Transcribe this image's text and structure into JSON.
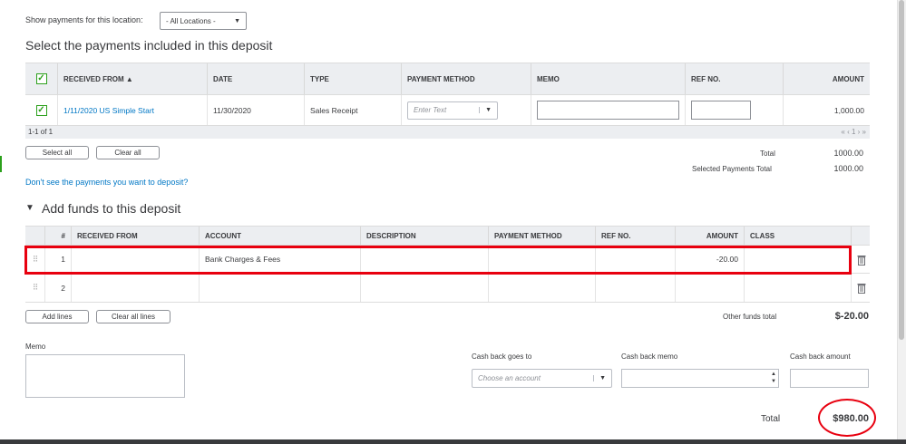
{
  "location_filter": {
    "label": "Show payments for this location:",
    "value": "- All Locations -"
  },
  "payments_section": {
    "title": "Select the payments included in this deposit",
    "columns": [
      "RECEIVED FROM ▲",
      "DATE",
      "TYPE",
      "PAYMENT METHOD",
      "MEMO",
      "REF NO.",
      "AMOUNT"
    ],
    "rows": [
      {
        "received_from": "1/11/2020 US Simple Start",
        "date": "11/30/2020",
        "type": "Sales Receipt",
        "payment_method_placeholder": "Enter Text",
        "memo": "",
        "ref_no": "",
        "amount": "1,000.00",
        "checked": true
      }
    ],
    "range": "1-1 of 1",
    "pager": "«  ‹  1  ›  »",
    "select_all": "Select all",
    "clear_all": "Clear all",
    "total_label": "Total",
    "total_value": "1000.00",
    "selected_total_label": "Selected Payments Total",
    "selected_total_value": "1000.00",
    "missing_link": "Don't see the payments you want to deposit?"
  },
  "funds_section": {
    "title": "Add funds to this deposit",
    "toggle": "▼",
    "columns": [
      "#",
      "RECEIVED FROM",
      "ACCOUNT",
      "DESCRIPTION",
      "PAYMENT METHOD",
      "REF NO.",
      "AMOUNT",
      "CLASS"
    ],
    "rows": [
      {
        "num": "1",
        "received_from": "",
        "account": "Bank Charges & Fees",
        "description": "",
        "payment_method": "",
        "ref_no": "",
        "amount": "-20.00",
        "class": ""
      },
      {
        "num": "2",
        "received_from": "",
        "account": "",
        "description": "",
        "payment_method": "",
        "ref_no": "",
        "amount": "",
        "class": ""
      }
    ],
    "add_lines": "Add lines",
    "clear_all_lines": "Clear all lines",
    "other_total_label": "Other funds total",
    "other_total_value": "$-20.00"
  },
  "memo": {
    "label": "Memo",
    "value": ""
  },
  "cash_back": {
    "goes_to_label": "Cash back goes to",
    "goes_to_placeholder": "Choose an account",
    "memo_label": "Cash back memo",
    "amount_label": "Cash back amount"
  },
  "grand_total": {
    "label": "Total",
    "value": "$980.00"
  },
  "icons": {
    "drag": "drag-handle-icon",
    "delete": "trash-icon",
    "sort": "sort-asc-icon"
  },
  "colors": {
    "accent_green": "#2ca01c",
    "link_blue": "#0077c5",
    "highlight_red": "#e8000f",
    "header_gray": "#eceef1"
  }
}
